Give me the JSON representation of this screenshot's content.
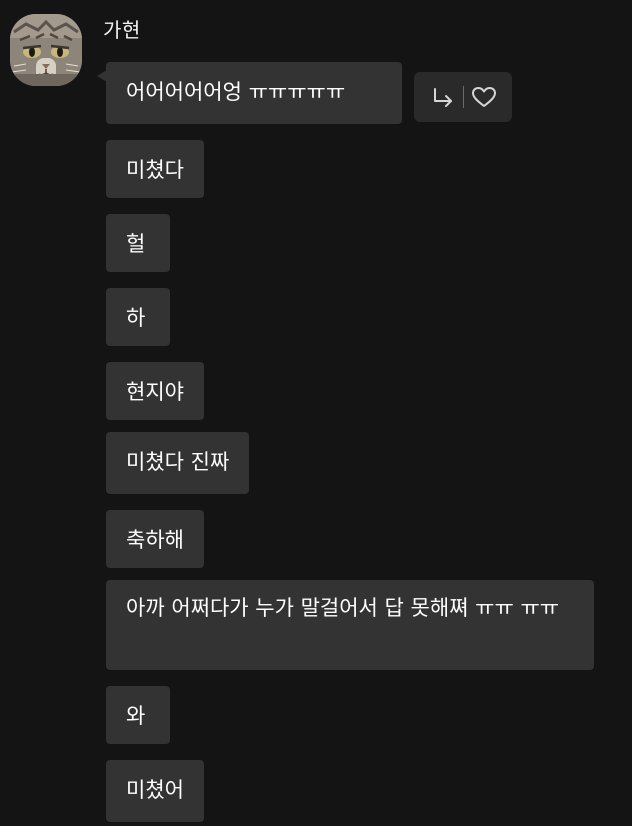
{
  "sender": {
    "name": "가현"
  },
  "messages": [
    {
      "text": "어어어어어엉 ㅠㅠㅠㅠㅠ"
    },
    {
      "text": "미쳤다"
    },
    {
      "text": "헐"
    },
    {
      "text": "하"
    },
    {
      "text": "현지야"
    },
    {
      "text": "미쳤다 진짜"
    },
    {
      "text": "축하해"
    },
    {
      "text": "아까 어쩌다가 누가 말걸어서 답 못해쪄 ㅠㅠ ㅠㅠ"
    },
    {
      "text": "와"
    },
    {
      "text": "미쳤어"
    }
  ],
  "actions": {
    "reply_icon": "reply-arrow-icon",
    "like_icon": "heart-icon"
  },
  "colors": {
    "background": "#141414",
    "bubble": "#333333",
    "text": "#ffffff"
  }
}
